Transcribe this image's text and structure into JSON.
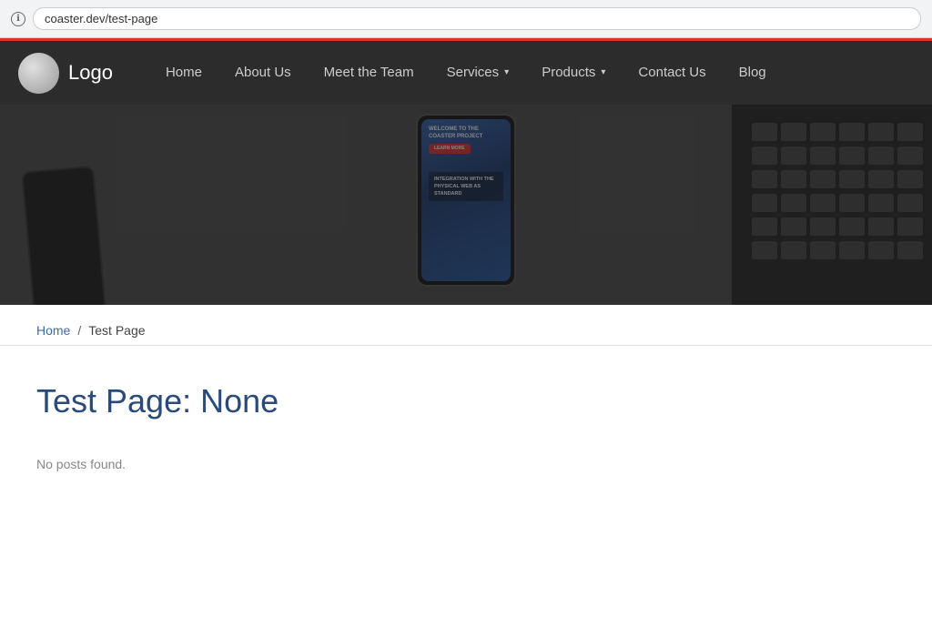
{
  "browser": {
    "url": "coaster.dev/test-page",
    "info_icon": "ℹ"
  },
  "navbar": {
    "logo_text": "Logo",
    "nav_items": [
      {
        "label": "Home",
        "has_dropdown": false
      },
      {
        "label": "About Us",
        "has_dropdown": false
      },
      {
        "label": "Meet the Team",
        "has_dropdown": false
      },
      {
        "label": "Services",
        "has_dropdown": true
      },
      {
        "label": "Products",
        "has_dropdown": true
      },
      {
        "label": "Contact Us",
        "has_dropdown": false
      },
      {
        "label": "Blog",
        "has_dropdown": false
      }
    ]
  },
  "phone_screen": {
    "welcome_text": "WELCOME TO THE COASTER PROJECT",
    "button_label": "LEARN MORE",
    "integration_text": "INTEGRATION WITH THE PHYSICAL WEB AS STANDARD"
  },
  "breadcrumb": {
    "home_label": "Home",
    "separator": "/",
    "current_label": "Test Page"
  },
  "main": {
    "page_title": "Test Page: None",
    "no_posts_text": "No posts found."
  }
}
